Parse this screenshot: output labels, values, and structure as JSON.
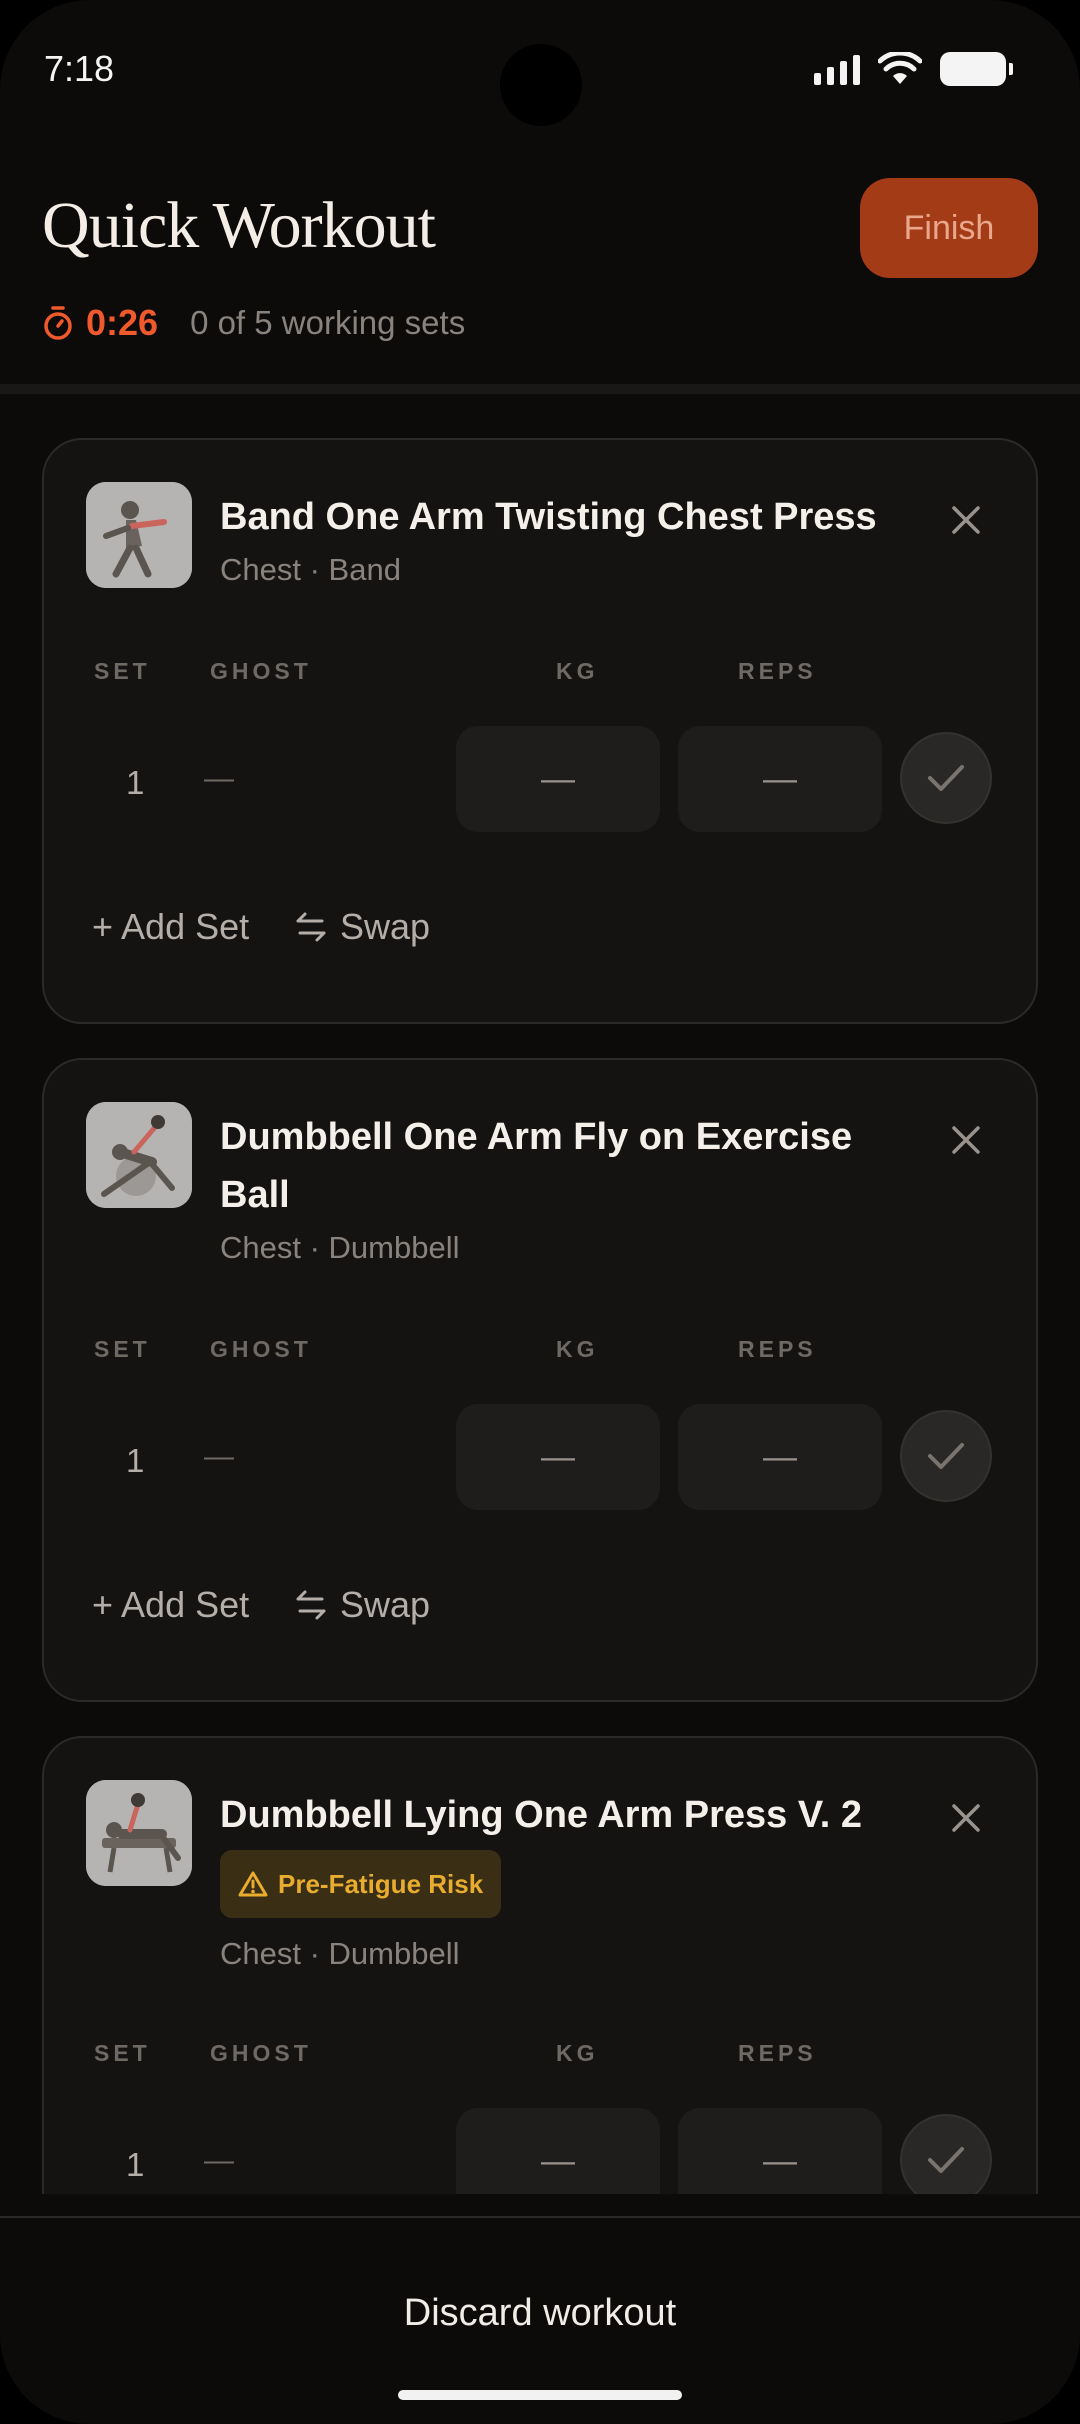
{
  "status_bar": {
    "time": "7:18"
  },
  "header": {
    "title": "Quick Workout",
    "finish_label": "Finish",
    "timer": "0:26",
    "sets_summary": "0 of 5 working sets"
  },
  "columns": {
    "set": "SET",
    "ghost": "GHOST",
    "kg": "KG",
    "reps": "REPS"
  },
  "exercises": [
    {
      "name": "Band One Arm Twisting Chest Press",
      "meta": "Chest · Band",
      "badge": null,
      "sets": [
        {
          "number": "1",
          "ghost": "—",
          "kg": "—",
          "reps": "—"
        }
      ],
      "add_set_label": "+ Add Set",
      "swap_label": "Swap"
    },
    {
      "name": "Dumbbell One Arm Fly on Exercise Ball",
      "meta": "Chest · Dumbbell",
      "badge": null,
      "sets": [
        {
          "number": "1",
          "ghost": "—",
          "kg": "—",
          "reps": "—"
        }
      ],
      "add_set_label": "+ Add Set",
      "swap_label": "Swap"
    },
    {
      "name": "Dumbbell Lying One Arm Press V. 2",
      "meta": "Chest · Dumbbell",
      "badge": "Pre-Fatigue Risk",
      "sets": [
        {
          "number": "1",
          "ghost": "—",
          "kg": "—",
          "reps": "—"
        }
      ]
    }
  ],
  "footer": {
    "discard_label": "Discard workout"
  },
  "colors": {
    "accent": "#f0592c",
    "finish_bg": "#a33b17",
    "warning": "#e8ac2f"
  }
}
